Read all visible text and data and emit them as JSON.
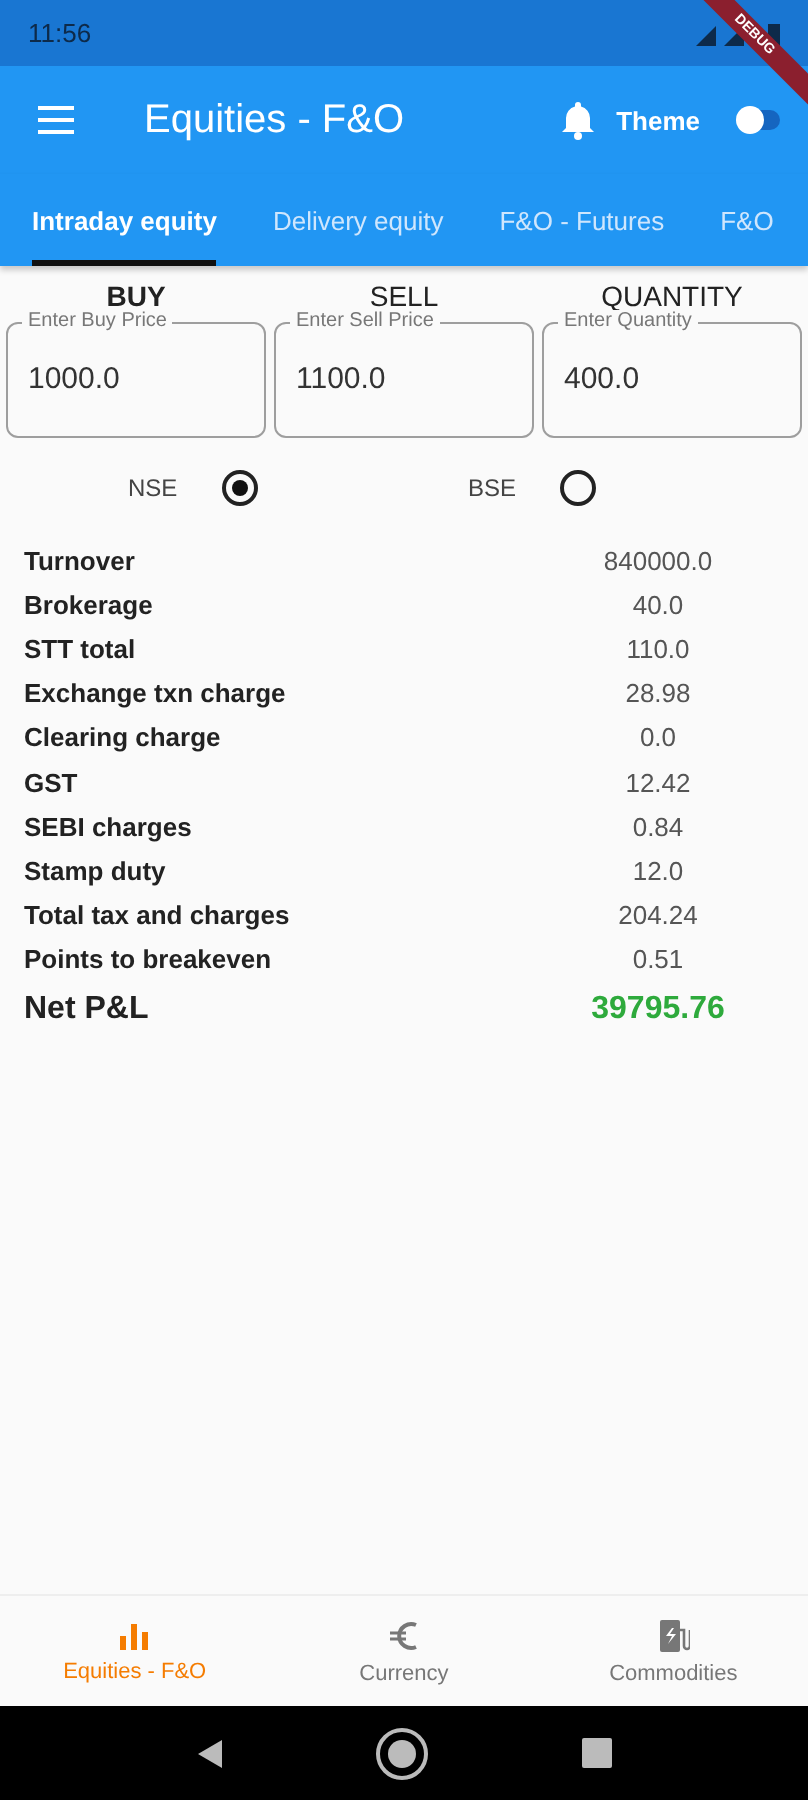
{
  "status_bar": {
    "time": "11:56"
  },
  "debug_banner": "DEBUG",
  "app_bar": {
    "title": "Equities - F&O",
    "theme_label": "Theme",
    "theme_on": false
  },
  "tabs": [
    {
      "label": "Intraday equity",
      "selected": true
    },
    {
      "label": "Delivery equity",
      "selected": false
    },
    {
      "label": "F&O - Futures",
      "selected": false
    },
    {
      "label": "F&O",
      "selected": false
    }
  ],
  "inputs": [
    {
      "heading": "BUY",
      "heading_bold": true,
      "placeholder": "Enter Buy Price",
      "value": "1000.0"
    },
    {
      "heading": "SELL",
      "heading_bold": false,
      "placeholder": "Enter Sell Price",
      "value": "1100.0"
    },
    {
      "heading": "QUANTITY",
      "heading_bold": false,
      "placeholder": "Enter Quantity",
      "value": "400.0"
    }
  ],
  "exchanges": [
    {
      "label": "NSE",
      "selected": true
    },
    {
      "label": "BSE",
      "selected": false
    }
  ],
  "results": [
    {
      "label": "Turnover",
      "value": "840000.0"
    },
    {
      "label": "Brokerage",
      "value": "40.0"
    },
    {
      "label": "STT total",
      "value": "110.0"
    },
    {
      "label": "Exchange txn charge",
      "value": "28.98"
    },
    {
      "label": "Clearing charge",
      "value": "0.0"
    },
    {
      "label": "GST",
      "value": "12.42"
    },
    {
      "label": "SEBI charges",
      "value": "0.84"
    },
    {
      "label": "Stamp duty",
      "value": "12.0"
    },
    {
      "label": "Total tax and charges",
      "value": "204.24"
    },
    {
      "label": "Points to breakeven",
      "value": "0.51"
    }
  ],
  "net": {
    "label": "Net P&L",
    "value": "39795.76",
    "color": "#2eaa3c"
  },
  "bottom_nav": [
    {
      "label": "Equities - F&O",
      "kind": "chart",
      "selected": true
    },
    {
      "label": "Currency",
      "kind": "euro",
      "selected": false
    },
    {
      "label": "Commodities",
      "kind": "fuel",
      "selected": false
    }
  ]
}
